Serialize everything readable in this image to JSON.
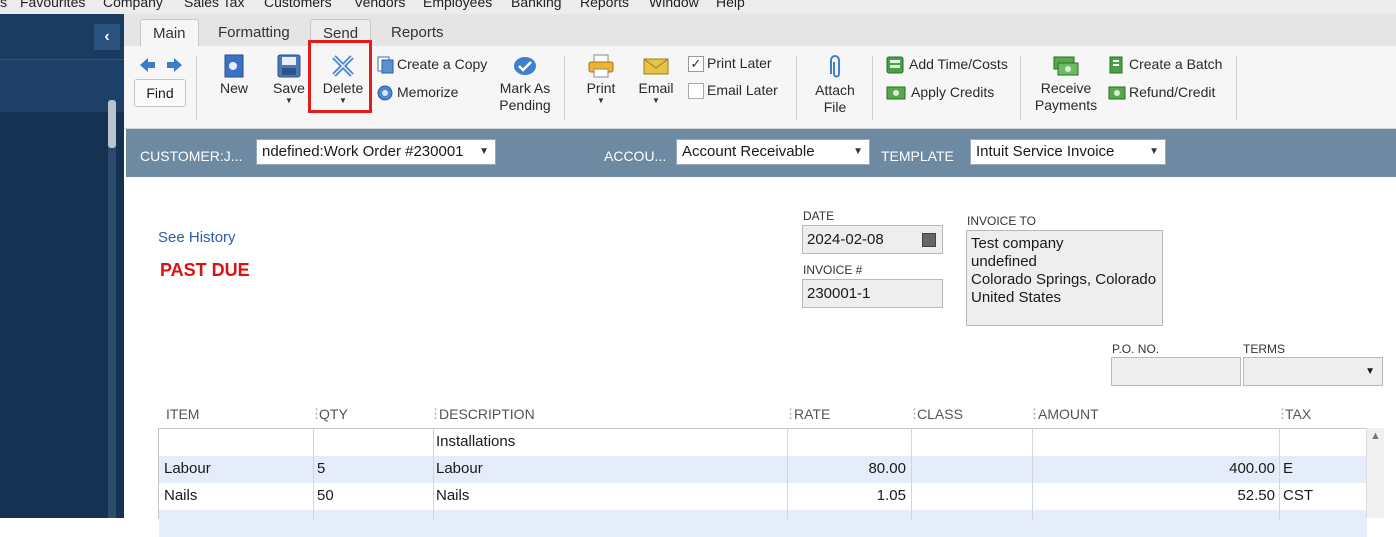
{
  "menu": [
    "s",
    "Favourites",
    "Company",
    "Sales Tax",
    "Customers",
    "Vendors",
    "Employees",
    "Banking",
    "Reports",
    "Window",
    "Help"
  ],
  "tabs": [
    "Main",
    "Formatting",
    "Send",
    "Reports"
  ],
  "toolbar": {
    "find": "Find",
    "new": "New",
    "save": "Save",
    "delete": "Delete",
    "create_copy": "Create a Copy",
    "memorize": "Memorize",
    "mark_as_pending_1": "Mark As",
    "mark_as_pending_2": "Pending",
    "print": "Print",
    "email": "Email",
    "print_later": "Print Later",
    "email_later": "Email Later",
    "attach_1": "Attach",
    "attach_2": "File",
    "add_time_costs": "Add Time/Costs",
    "apply_credits": "Apply Credits",
    "receive_1": "Receive",
    "receive_2": "Payments",
    "create_batch": "Create a Batch",
    "refund_credit": "Refund/Credit",
    "print_later_checked": true,
    "email_later_checked": false
  },
  "customer_bar": {
    "customer_label": "CUSTOMER:J...",
    "customer_value": "ndefined:Work Order #230001",
    "account_label": "ACCOU...",
    "account_value": "Account Receivable",
    "template_label": "TEMPLATE",
    "template_value": "Intuit Service Invoice"
  },
  "form": {
    "see_history": "See History",
    "status": "PAST DUE",
    "date_label": "DATE",
    "date_value": "2024-02-08",
    "invoice_label": "INVOICE #",
    "invoice_value": "230001-1",
    "invoice_to_label": "INVOICE TO",
    "invoice_to_lines": [
      "Test company",
      "undefined",
      "Colorado Springs, Colorado",
      "United States"
    ],
    "po_label": "P.O. NO.",
    "terms_label": "TERMS",
    "po_value": "",
    "terms_value": ""
  },
  "table": {
    "headers": [
      "ITEM",
      "QTY",
      "DESCRIPTION",
      "RATE",
      "CLASS",
      "AMOUNT",
      "TAX"
    ],
    "rows": [
      {
        "item": "",
        "qty": "",
        "description": "Installations",
        "rate": "",
        "class": "",
        "amount": "",
        "tax": ""
      },
      {
        "item": "Labour",
        "qty": "5",
        "description": "Labour",
        "rate": "80.00",
        "class": "",
        "amount": "400.00",
        "tax": "E"
      },
      {
        "item": "Nails",
        "qty": "50",
        "description": "Nails",
        "rate": "1.05",
        "class": "",
        "amount": "52.50",
        "tax": "CST"
      },
      {
        "item": "",
        "qty": "",
        "description": "",
        "rate": "",
        "class": "",
        "amount": "",
        "tax": ""
      }
    ]
  },
  "colors": {
    "sidebar": "#163252",
    "customer_bar": "#6e8aa3",
    "past_due": "#e01010",
    "highlight": "#e21b1b",
    "link": "#2a5ea8"
  }
}
